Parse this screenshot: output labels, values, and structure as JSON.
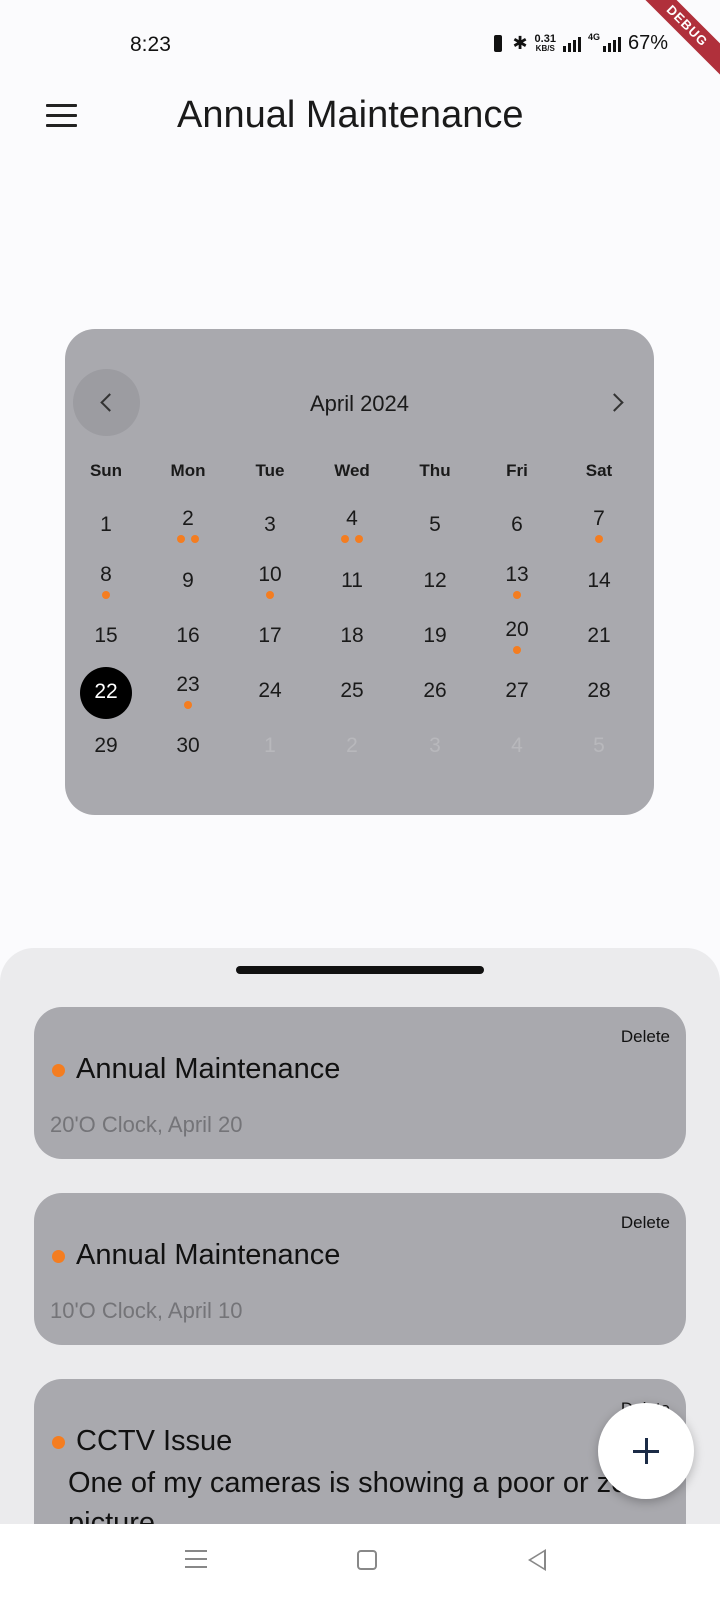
{
  "status_bar": {
    "time": "8:23",
    "speed_value": "0.31",
    "speed_unit": "KB/S",
    "network": "4G",
    "battery": "67%"
  },
  "debug_banner": "DEBUG",
  "app_bar": {
    "title": "Annual Maintenance",
    "menu_icon": "hamburger-menu-icon"
  },
  "calendar": {
    "month_label": "April 2024",
    "weekdays": [
      "Sun",
      "Mon",
      "Tue",
      "Wed",
      "Thu",
      "Fri",
      "Sat"
    ],
    "selected_day": "22",
    "weeks": [
      [
        {
          "d": "1",
          "e": 0
        },
        {
          "d": "2",
          "e": 2
        },
        {
          "d": "3",
          "e": 0
        },
        {
          "d": "4",
          "e": 2
        },
        {
          "d": "5",
          "e": 0
        },
        {
          "d": "6",
          "e": 0
        },
        {
          "d": "7",
          "e": 1
        }
      ],
      [
        {
          "d": "8",
          "e": 1
        },
        {
          "d": "9",
          "e": 0
        },
        {
          "d": "10",
          "e": 1
        },
        {
          "d": "11",
          "e": 0
        },
        {
          "d": "12",
          "e": 0
        },
        {
          "d": "13",
          "e": 1
        },
        {
          "d": "14",
          "e": 0
        }
      ],
      [
        {
          "d": "15",
          "e": 0
        },
        {
          "d": "16",
          "e": 0
        },
        {
          "d": "17",
          "e": 0
        },
        {
          "d": "18",
          "e": 0
        },
        {
          "d": "19",
          "e": 0
        },
        {
          "d": "20",
          "e": 1
        },
        {
          "d": "21",
          "e": 0
        }
      ],
      [
        {
          "d": "22",
          "e": 0
        },
        {
          "d": "23",
          "e": 1
        },
        {
          "d": "24",
          "e": 0
        },
        {
          "d": "25",
          "e": 0
        },
        {
          "d": "26",
          "e": 0
        },
        {
          "d": "27",
          "e": 0
        },
        {
          "d": "28",
          "e": 0
        }
      ],
      [
        {
          "d": "29",
          "e": 0
        },
        {
          "d": "30",
          "e": 0
        },
        {
          "d": "1",
          "e": 0,
          "out": true
        },
        {
          "d": "2",
          "e": 0,
          "out": true
        },
        {
          "d": "3",
          "e": 0,
          "out": true
        },
        {
          "d": "4",
          "e": 0,
          "out": true
        },
        {
          "d": "5",
          "e": 0,
          "out": true
        }
      ]
    ],
    "event_dot_color": "#f47d20"
  },
  "events": [
    {
      "title": "Annual Maintenance",
      "subtitle": "20'O Clock, April 20",
      "delete_label": "Delete"
    },
    {
      "title": "Annual Maintenance",
      "subtitle": "10'O Clock, April 10",
      "delete_label": "Delete"
    },
    {
      "title": "CCTV Issue",
      "description": "One of my cameras is showing a poor or zero picture",
      "delete_label": "Delete"
    }
  ],
  "fab": {
    "icon": "plus-icon"
  }
}
